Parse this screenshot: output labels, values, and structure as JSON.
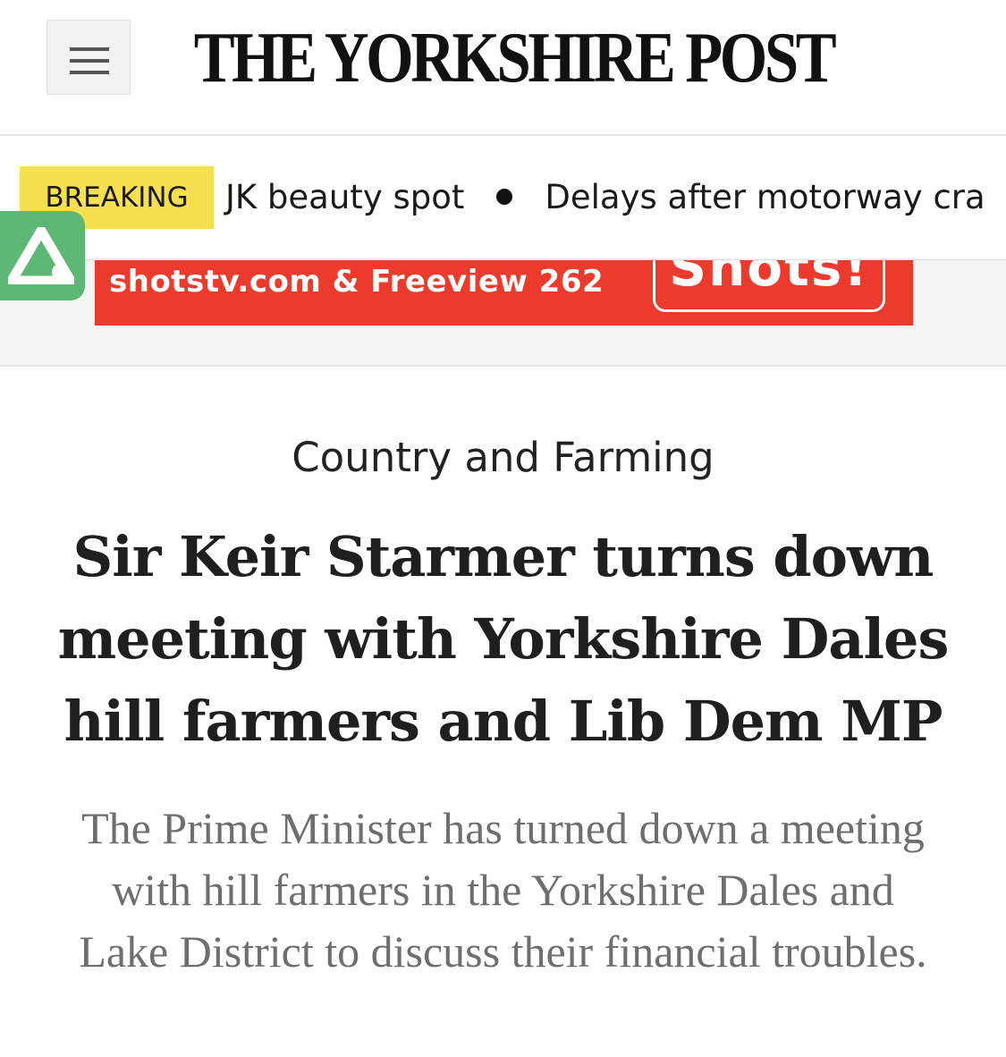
{
  "header": {
    "masthead": "THE YORKSHIRE POST",
    "menu_icon": "hamburger-menu-icon"
  },
  "ticker": {
    "badge": "BREAKING",
    "items": [
      "JK beauty spot",
      "Delays after motorway cra"
    ],
    "separator_icon": "bullet-dot-icon"
  },
  "ad": {
    "text": "shotstv.com & Freeview 262",
    "logo_text": "Shots!"
  },
  "app_badge": {
    "icon": "triangle-logo-icon"
  },
  "article": {
    "category": "Country and Farming",
    "headline": "Sir Keir Starmer turns down meeting with Yorkshire Dales hill farmers and Lib Dem MP",
    "standfirst": "The Prime Minister has turned down a meeting with hill farmers in the Yorkshire Dales and Lake District to discuss their financial troubles."
  },
  "colors": {
    "breaking_badge": "#f7e04e",
    "ad_red": "#ec3b2c",
    "app_badge_green": "#5cb874",
    "headline_text": "#1f1f1f",
    "standfirst_text": "#6e6e6e"
  }
}
